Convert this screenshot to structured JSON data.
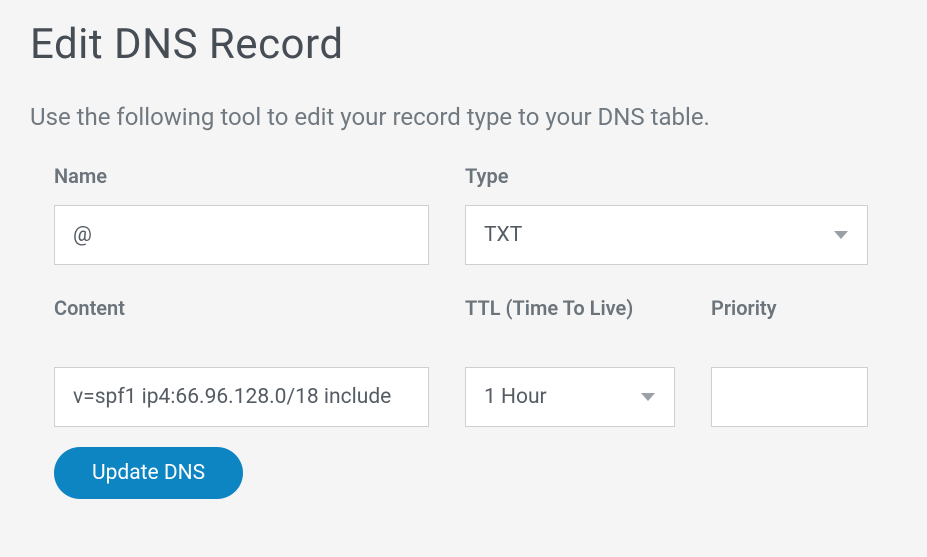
{
  "title": "Edit DNS Record",
  "description": "Use the following tool to edit your record type to your DNS table.",
  "fields": {
    "name": {
      "label": "Name",
      "value": "@"
    },
    "type": {
      "label": "Type",
      "selected": "TXT"
    },
    "content": {
      "label": "Content",
      "value": "v=spf1 ip4:66.96.128.0/18 include"
    },
    "ttl": {
      "label": "TTL (Time To Live)",
      "selected": "1 Hour"
    },
    "priority": {
      "label": "Priority",
      "value": ""
    }
  },
  "buttons": {
    "update": "Update DNS"
  }
}
